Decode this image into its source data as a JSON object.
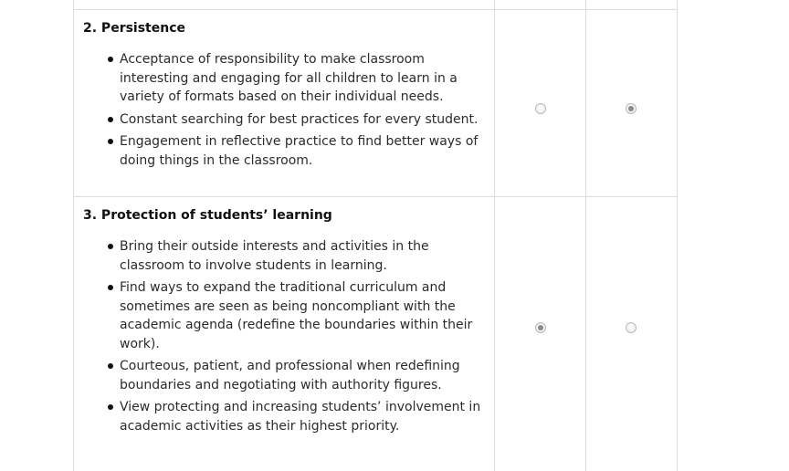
{
  "rows": [
    {
      "title": "2. Persistence",
      "bullets": [
        "Acceptance of responsibility to make classroom interesting and engaging for all children to learn in a variety of formats based on their individual needs.",
        "Constant searching for best practices for every student.",
        "Engagement in reflective practice to find better ways of doing things in the classroom."
      ],
      "selected_option": 2
    },
    {
      "title": "3. Protection of students’ learning",
      "bullets": [
        "Bring their outside interests and activities in the classroom to involve students in learning.",
        "Find ways to expand the traditional curriculum and sometimes are seen as being noncompliant with the academic agenda (redefine the boundaries within their work).",
        "Courteous, patient, and professional when redefining boundaries and negotiating with authority figures.",
        "View protecting and increasing students’ involvement in academic activities as their highest priority."
      ],
      "selected_option": 1
    }
  ],
  "colors": {
    "border": "#dddddd",
    "text": "#2b2b2b",
    "radio_selected": "#8a8a8a"
  }
}
